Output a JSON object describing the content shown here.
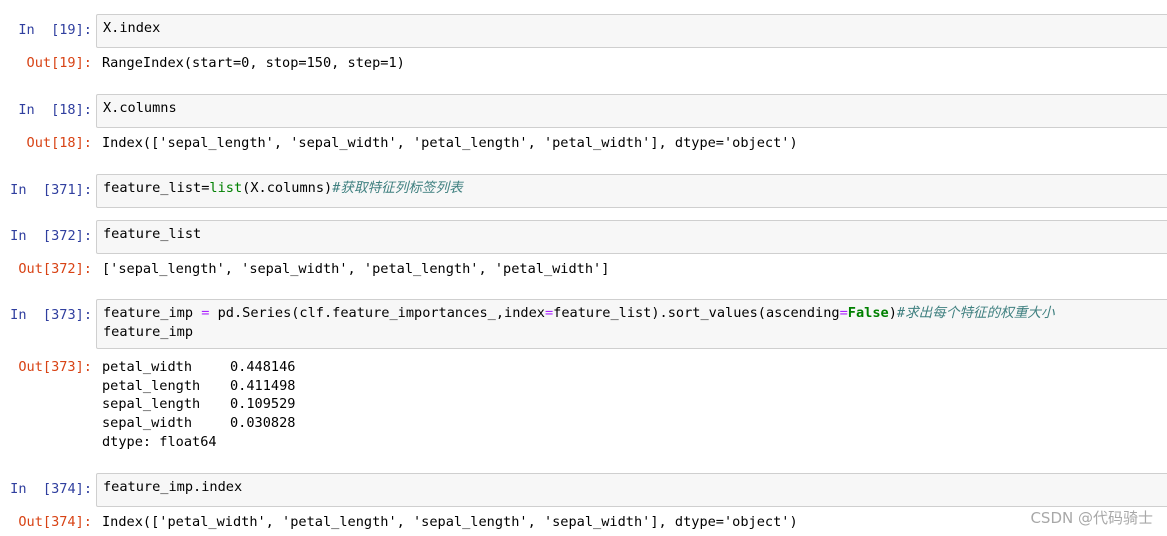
{
  "cells": [
    {
      "in_prompt": "In  [19]:",
      "input_lines": [
        "X.index"
      ],
      "out_prompt": "Out[19]:",
      "output": "RangeIndex(start=0, stop=150, step=1)"
    },
    {
      "in_prompt": "In  [18]:",
      "input_lines": [
        "X.columns"
      ],
      "out_prompt": "Out[18]:",
      "output": "Index(['sepal_length', 'sepal_width', 'petal_length', 'petal_width'], dtype='object')"
    },
    {
      "in_prompt": "In  [371]:",
      "input_parts": {
        "a": "feature_list=",
        "builtin": "list",
        "b": "(X.columns)",
        "comment": "#获取特征列标签列表"
      }
    },
    {
      "in_prompt": "In  [372]:",
      "input_lines": [
        "feature_list"
      ],
      "out_prompt": "Out[372]:",
      "output": "['sepal_length', 'sepal_width', 'petal_length', 'petal_width']"
    },
    {
      "in_prompt": "In  [373]:",
      "input_parts": {
        "a": "feature_imp ",
        "eq1": "=",
        "b": " pd.Series(clf.feature_importances_,index",
        "eq2": "=",
        "c": "feature_list).sort_values(ascending",
        "eq3": "=",
        "bool": "False",
        "d": ")",
        "comment": "#求出每个特征的权重大小",
        "line2": "feature_imp"
      },
      "out_prompt": "Out[373]:",
      "series": [
        {
          "name": "petal_width",
          "value": "0.448146"
        },
        {
          "name": "petal_length",
          "value": "0.411498"
        },
        {
          "name": "sepal_length",
          "value": "0.109529"
        },
        {
          "name": "sepal_width",
          "value": "0.030828"
        }
      ],
      "dtype": "dtype: float64"
    },
    {
      "in_prompt": "In  [374]:",
      "input_lines": [
        "feature_imp.index"
      ],
      "out_prompt": "Out[374]:",
      "output": "Index(['petal_width', 'petal_length', 'sepal_length', 'sepal_width'], dtype='object')"
    }
  ],
  "watermark": "CSDN @代码骑士",
  "colors": {
    "in_prompt": "#303f9f",
    "out_prompt": "#d84315",
    "builtin": "#008000",
    "operator": "#aa22ff",
    "comment": "#408080",
    "cell_bg": "#f7f7f7",
    "cell_border": "#cfcfcf"
  }
}
